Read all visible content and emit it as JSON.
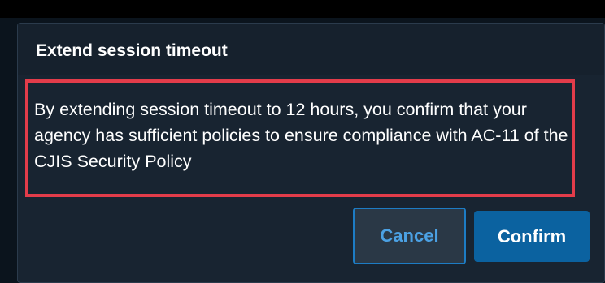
{
  "dialog": {
    "title": "Extend session timeout",
    "message": "By extending session timeout to 12 hours, you confirm that your agency has sufficient policies to ensure compliance with AC-11 of the CJIS Security Policy",
    "cancel_label": "Cancel",
    "confirm_label": "Confirm"
  },
  "colors": {
    "dialog_background": "#182431",
    "highlight_border": "#e23c4a",
    "cancel_text": "#4ba1e4",
    "cancel_border": "#1d7cc4",
    "confirm_background": "#0b62a0",
    "text": "#ffffff"
  }
}
